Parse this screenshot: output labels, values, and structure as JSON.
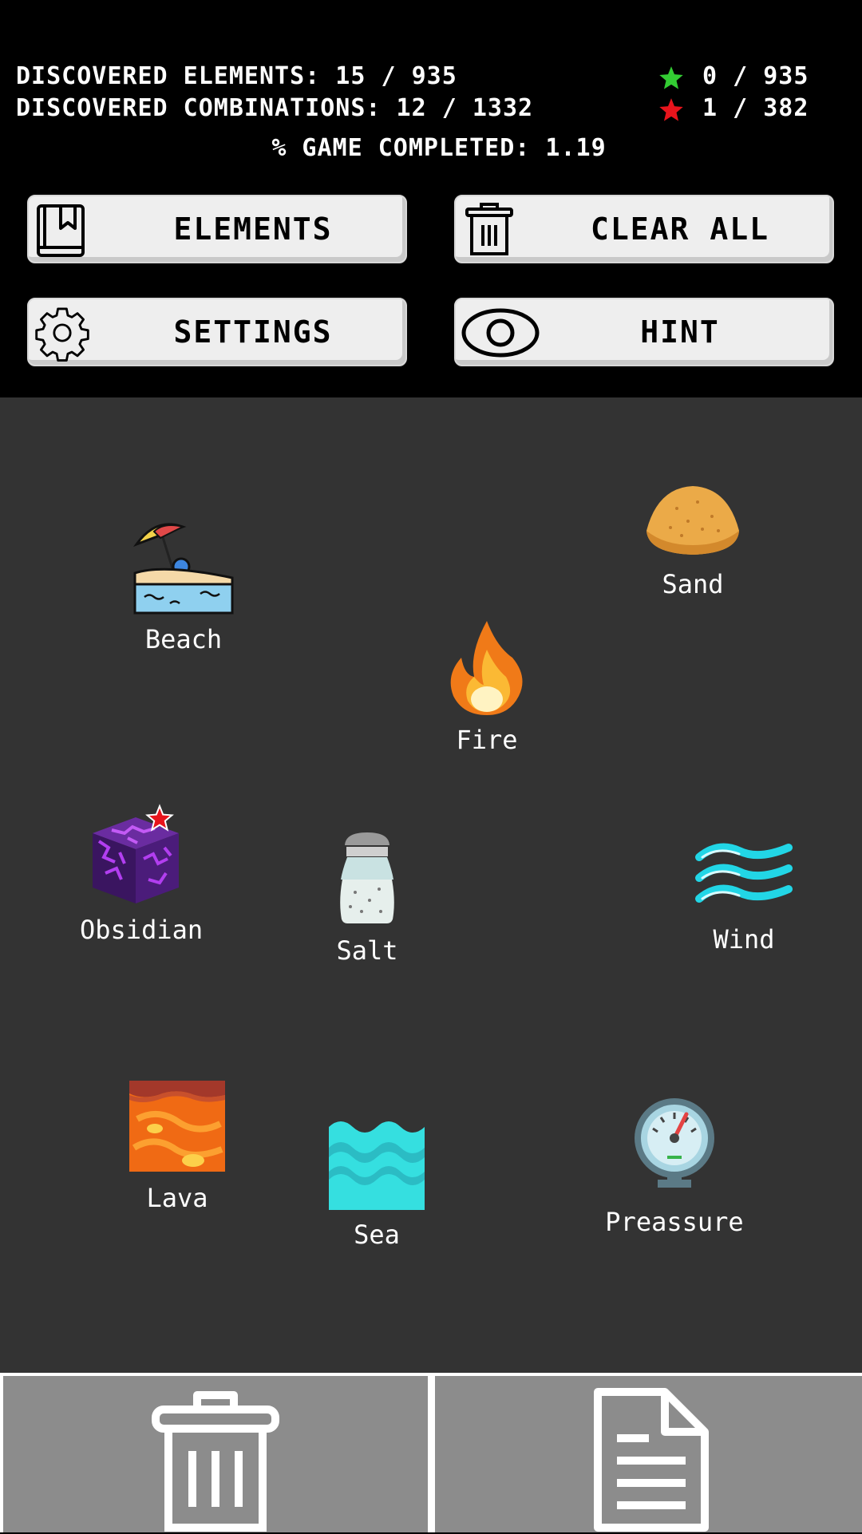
{
  "stats": {
    "discovered_elements": "DISCOVERED ELEMENTS: 15 / 935",
    "discovered_combinations": "DISCOVERED COMBINATIONS: 12 / 1332",
    "green_star_count": "0 / 935",
    "red_star_count": "1 / 382",
    "game_completed": "% GAME COMPLETED: 1.19"
  },
  "buttons": {
    "elements": "ELEMENTS",
    "clear_all": "CLEAR ALL",
    "settings": "SETTINGS",
    "hint": "HINT"
  },
  "elements": [
    {
      "name": "Beach",
      "icon": "beach-icon"
    },
    {
      "name": "Sand",
      "icon": "sand-icon"
    },
    {
      "name": "Fire",
      "icon": "fire-icon"
    },
    {
      "name": "Obsidian",
      "icon": "obsidian-icon",
      "starred": true
    },
    {
      "name": "Salt",
      "icon": "salt-icon"
    },
    {
      "name": "Wind",
      "icon": "wind-icon"
    },
    {
      "name": "Lava",
      "icon": "lava-icon"
    },
    {
      "name": "Sea",
      "icon": "sea-icon"
    },
    {
      "name": "Preassure",
      "icon": "pressure-gauge-icon"
    }
  ],
  "colors": {
    "board": "#333333",
    "green_star": "#33cc33",
    "red_star": "#e8141c",
    "bottom_bar": "#8c8c8c"
  }
}
